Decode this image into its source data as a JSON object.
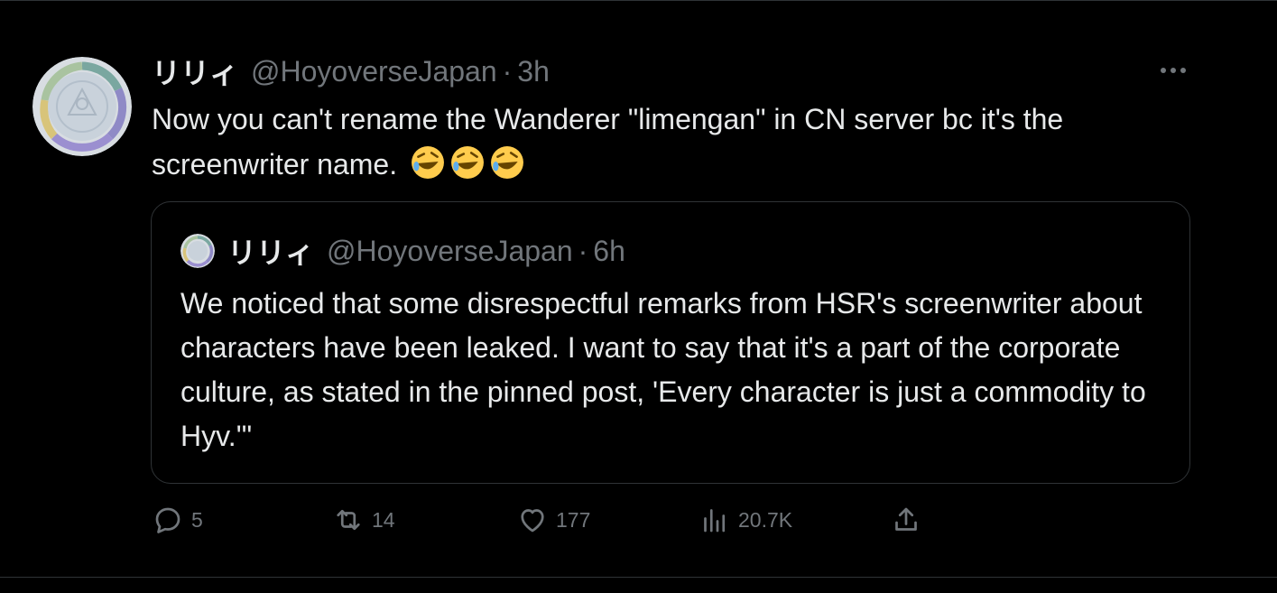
{
  "tweet": {
    "display_name": "リリィ",
    "handle": "@HoyoverseJapan",
    "separator": "·",
    "time": "3h",
    "text": "Now you can't rename the Wanderer \"limengan\" in CN server bc it's the screenwriter name.",
    "emojis": [
      "rolling-on-floor-laughing",
      "rolling-on-floor-laughing",
      "rolling-on-floor-laughing"
    ],
    "more_icon": "more-horizontal-icon"
  },
  "quote": {
    "display_name": "リリィ",
    "handle": "@HoyoverseJapan",
    "separator": "·",
    "time": "6h",
    "text": "We noticed that some disrespectful remarks from HSR's screenwriter about characters have been leaked. I want to say that it's a part of the corporate culture, as stated in the pinned post, 'Every character is just a commodity to Hyv.'\""
  },
  "actions": {
    "replies": "5",
    "reposts": "14",
    "likes": "177",
    "views": "20.7K"
  },
  "colors": {
    "background": "#000000",
    "text": "#e7e9ea",
    "secondary": "#71767b",
    "border": "#2f3336"
  }
}
